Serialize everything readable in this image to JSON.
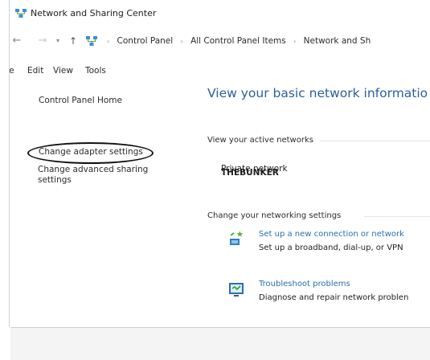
{
  "window": {
    "title": "Network and Sharing Center"
  },
  "address": {
    "back_glyph": "←",
    "forward_glyph": "→",
    "dropdown_glyph": "▾",
    "up_glyph": "↑",
    "crumbs": [
      "Control Panel",
      "All Control Panel Items",
      "Network and Sh"
    ],
    "separator": "›",
    "icon": "network-center-icon"
  },
  "menu": {
    "items": [
      "File",
      "Edit",
      "View",
      "Tools"
    ]
  },
  "nav": {
    "home": "Control Panel Home",
    "adapter": "Change adapter settings",
    "sharing": "Change advanced sharing settings"
  },
  "content": {
    "heading": "View your basic network informatio",
    "active_label": "View your active networks",
    "network_name": "THEBUNKER",
    "network_type": "Private network",
    "change_label": "Change your networking settings",
    "settings": [
      {
        "icon": "new-connection-icon",
        "link": "Set up a new connection or network",
        "desc": "Set up a broadband, dial-up, or VPN"
      },
      {
        "icon": "troubleshoot-icon",
        "link": "Troubleshoot problems",
        "desc": "Diagnose and repair network problen"
      }
    ]
  },
  "colors": {
    "heading": "#2a5f9e",
    "link": "#2a6fb0",
    "annotation": "#111111"
  }
}
